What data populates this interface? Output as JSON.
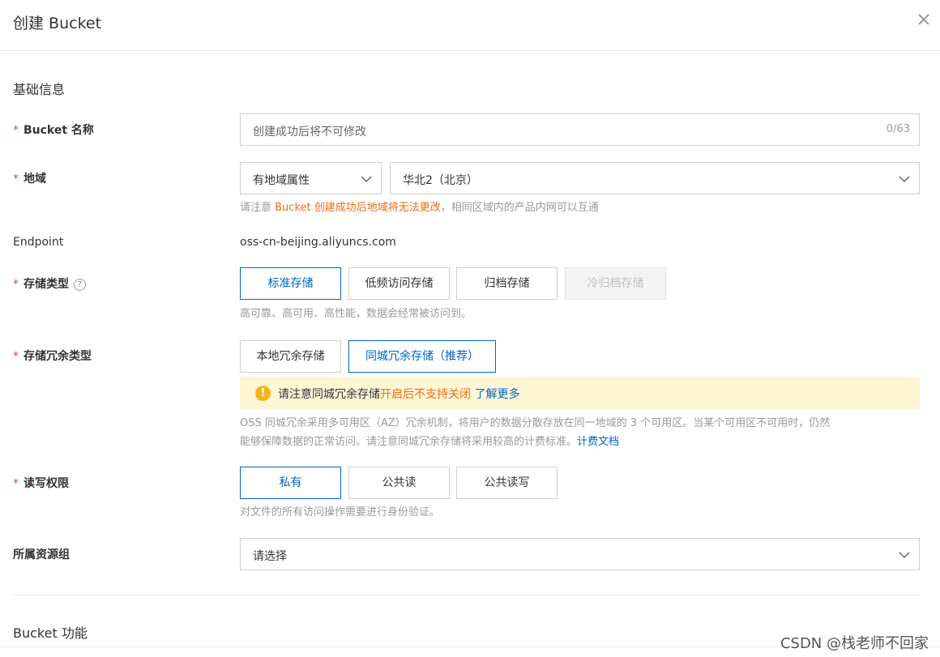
{
  "dialog": {
    "title": "创建 Bucket",
    "close_icon": "close-icon"
  },
  "sections": {
    "basic": "基础信息",
    "features": "Bucket 功能"
  },
  "fields": {
    "bucket_name": {
      "label": "Bucket 名称",
      "placeholder": "创建成功后将不可修改",
      "counter": "0/63"
    },
    "region": {
      "label": "地域",
      "attr_select": "有地域属性",
      "region_select": "华北2（北京）",
      "hint_prefix": "请注意 ",
      "hint_warn": "Bucket 创建成功后地域将无法更改",
      "hint_suffix": "，相同区域内的产品内网可以互通"
    },
    "endpoint": {
      "label": "Endpoint",
      "value": "oss-cn-beijing.aliyuncs.com"
    },
    "storage_class": {
      "label": "存储类型",
      "help_icon": "question-circle-icon",
      "options": [
        "标准存储",
        "低频访问存储",
        "归档存储",
        "冷归档存储"
      ],
      "selected": "标准存储",
      "hint": "高可靠、高可用、高性能，数据会经常被访问到。"
    },
    "redundancy": {
      "label": "存储冗余类型",
      "options": [
        "本地冗余存储",
        "同城冗余存储（推荐）"
      ],
      "selected": "同城冗余存储（推荐）",
      "alert_prefix": "请注意同城冗余存储",
      "alert_warn": "开启后不支持关闭",
      "alert_link": "了解更多",
      "alert_icon": "exclamation-circle-icon",
      "hint_line1": "OSS 同城冗余采用多可用区（AZ）冗余机制，将用户的数据分散存放在同一地域的 3 个可用区。当某个可用区不可用时，仍然",
      "hint_line2": "能够保障数据的正常访问。请注意同城冗余存储将采用较高的计费标准。",
      "hint_link": "计费文档"
    },
    "acl": {
      "label": "读写权限",
      "options": [
        "私有",
        "公共读",
        "公共读写"
      ],
      "selected": "私有",
      "hint": "对文件的所有访问操作需要进行身份验证。"
    },
    "resource_group": {
      "label": "所属资源组",
      "placeholder": "请选择"
    }
  },
  "watermark": "CSDN @栈老师不回家",
  "colors": {
    "accent": "#0064c8",
    "warning": "#f06a0f",
    "required": "#e84a3b",
    "alert_bg": "#fff6d5"
  }
}
